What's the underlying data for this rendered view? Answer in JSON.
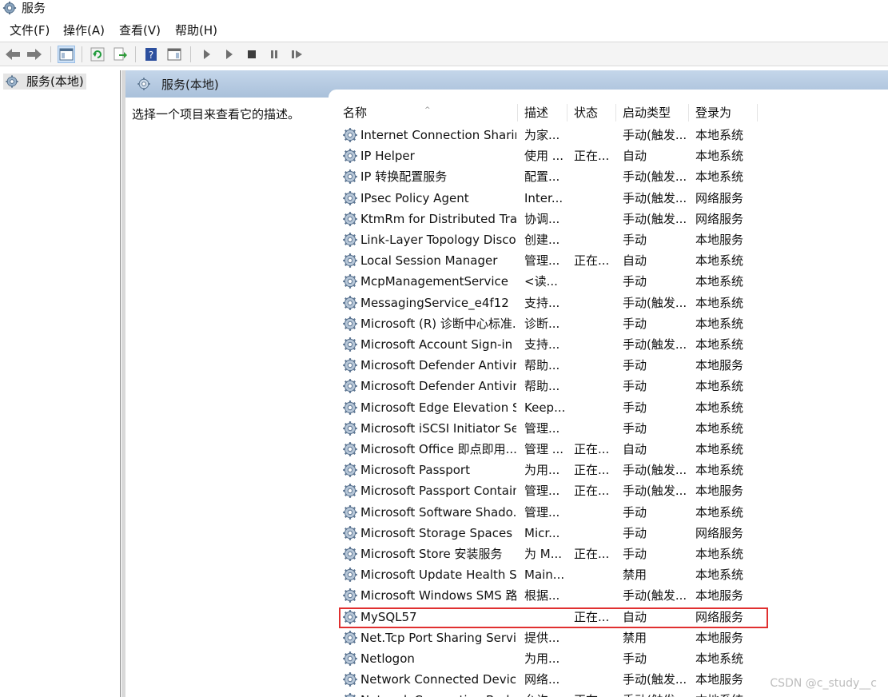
{
  "window": {
    "title": "服务"
  },
  "menu": [
    "文件(F)",
    "操作(A)",
    "查看(V)",
    "帮助(H)"
  ],
  "toolbar": {
    "buttons": [
      "back-icon",
      "forward-icon",
      "show-hide-console-tree-icon",
      "refresh-icon",
      "export-list-icon",
      "help-icon",
      "properties-pane-icon",
      "start-service-icon",
      "start-service-alt-icon",
      "stop-service-icon",
      "pause-service-icon",
      "resume-service-icon"
    ]
  },
  "tree": {
    "item_label": "服务(本地)"
  },
  "pane": {
    "header_label": "服务(本地)",
    "description_prompt": "选择一个项目来查看它的描述。"
  },
  "columns": [
    "名称",
    "描述",
    "状态",
    "启动类型",
    "登录为"
  ],
  "rows": [
    {
      "name": "Internet Connection Sharin...",
      "desc": "为家...",
      "state": "",
      "start": "手动(触发...",
      "logon": "本地系统"
    },
    {
      "name": "IP Helper",
      "desc": "使用 ...",
      "state": "正在...",
      "start": "自动",
      "logon": "本地系统"
    },
    {
      "name": "IP 转换配置服务",
      "desc": "配置...",
      "state": "",
      "start": "手动(触发...",
      "logon": "本地系统"
    },
    {
      "name": "IPsec Policy Agent",
      "desc": "Inter...",
      "state": "",
      "start": "手动(触发...",
      "logon": "网络服务"
    },
    {
      "name": "KtmRm for Distributed Tra...",
      "desc": "协调...",
      "state": "",
      "start": "手动(触发...",
      "logon": "网络服务"
    },
    {
      "name": "Link-Layer Topology Disco...",
      "desc": "创建...",
      "state": "",
      "start": "手动",
      "logon": "本地服务"
    },
    {
      "name": "Local Session Manager",
      "desc": "管理...",
      "state": "正在...",
      "start": "自动",
      "logon": "本地系统"
    },
    {
      "name": "McpManagementService",
      "desc": "<读...",
      "state": "",
      "start": "手动",
      "logon": "本地系统"
    },
    {
      "name": "MessagingService_e4f12",
      "desc": "支持...",
      "state": "",
      "start": "手动(触发...",
      "logon": "本地系统"
    },
    {
      "name": "Microsoft (R) 诊断中心标准...",
      "desc": "诊断...",
      "state": "",
      "start": "手动",
      "logon": "本地系统"
    },
    {
      "name": "Microsoft Account Sign-in ...",
      "desc": "支持...",
      "state": "",
      "start": "手动(触发...",
      "logon": "本地系统"
    },
    {
      "name": "Microsoft Defender Antivir...",
      "desc": "帮助...",
      "state": "",
      "start": "手动",
      "logon": "本地服务"
    },
    {
      "name": "Microsoft Defender Antivir...",
      "desc": "帮助...",
      "state": "",
      "start": "手动",
      "logon": "本地系统"
    },
    {
      "name": "Microsoft Edge Elevation S...",
      "desc": "Keep...",
      "state": "",
      "start": "手动",
      "logon": "本地系统"
    },
    {
      "name": "Microsoft iSCSI Initiator Ser...",
      "desc": "管理...",
      "state": "",
      "start": "手动",
      "logon": "本地系统"
    },
    {
      "name": "Microsoft Office 即点即用...",
      "desc": "管理 ...",
      "state": "正在...",
      "start": "自动",
      "logon": "本地系统"
    },
    {
      "name": "Microsoft Passport",
      "desc": "为用...",
      "state": "正在...",
      "start": "手动(触发...",
      "logon": "本地系统"
    },
    {
      "name": "Microsoft Passport Container",
      "desc": "管理...",
      "state": "正在...",
      "start": "手动(触发...",
      "logon": "本地服务"
    },
    {
      "name": "Microsoft Software Shado...",
      "desc": "管理...",
      "state": "",
      "start": "手动",
      "logon": "本地系统"
    },
    {
      "name": "Microsoft Storage Spaces S...",
      "desc": "Micr...",
      "state": "",
      "start": "手动",
      "logon": "网络服务"
    },
    {
      "name": "Microsoft Store 安装服务",
      "desc": "为 M...",
      "state": "正在...",
      "start": "手动",
      "logon": "本地系统"
    },
    {
      "name": "Microsoft Update Health S...",
      "desc": "Main...",
      "state": "",
      "start": "禁用",
      "logon": "本地系统"
    },
    {
      "name": "Microsoft Windows SMS 路...",
      "desc": "根据...",
      "state": "",
      "start": "手动(触发...",
      "logon": "本地服务"
    },
    {
      "name": "MySQL57",
      "desc": "",
      "state": "正在...",
      "start": "自动",
      "logon": "网络服务"
    },
    {
      "name": "Net.Tcp Port Sharing Service",
      "desc": "提供...",
      "state": "",
      "start": "禁用",
      "logon": "本地服务"
    },
    {
      "name": "Netlogon",
      "desc": "为用...",
      "state": "",
      "start": "手动",
      "logon": "本地系统"
    },
    {
      "name": "Network Connected Devic...",
      "desc": "网络...",
      "state": "",
      "start": "手动(触发...",
      "logon": "本地服务"
    },
    {
      "name": "Network Connection Broker",
      "desc": "允许...",
      "state": "正在...",
      "start": "手动(触发...",
      "logon": "本地系统"
    }
  ],
  "highlighted_row": "MySQL57",
  "watermark": "CSDN @c_study__c",
  "colors": {
    "highlight_border": "#e03030",
    "header_band": "#b5c9e0",
    "selected_tree": "#e5e5e5"
  }
}
